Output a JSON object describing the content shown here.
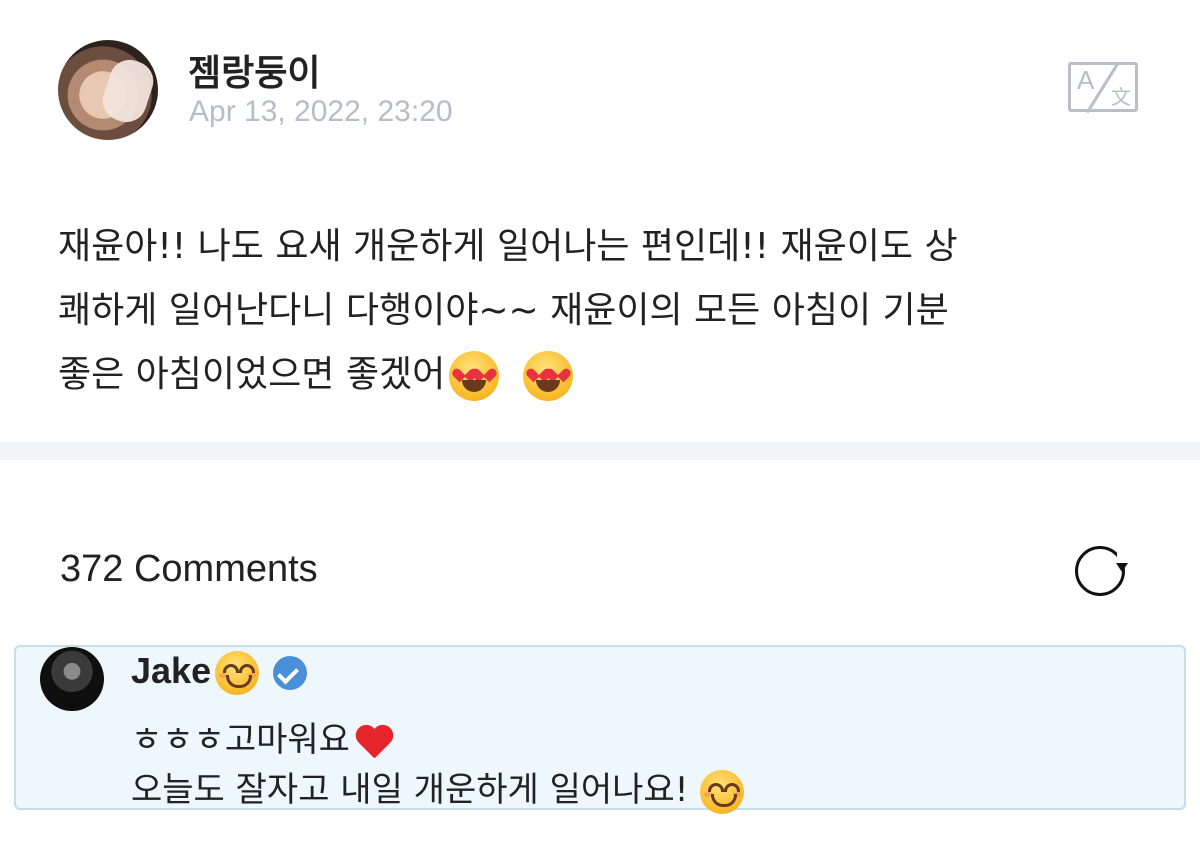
{
  "post": {
    "author": "젬랑둥이",
    "date": "Apr 13, 2022, 23:20",
    "body_line1": "재윤아!! 나도 요새 개운하게 일어나는 편인데!! 재윤이도 상",
    "body_line2": "쾌하게 일어난다니 다행이야~~ 재윤이의 모든 아침이 기분",
    "body_line3": "좋은 아침이었으면 좋겠어",
    "body_emojis": [
      "heart-eyes-emoji",
      "heart-eyes-emoji"
    ]
  },
  "translate": {
    "icon": "translate-icon",
    "left_glyph": "A",
    "right_glyph": "文"
  },
  "comments": {
    "header": "372 Comments",
    "refresh_icon": "refresh-icon",
    "items": [
      {
        "author": "Jake",
        "author_emoji": "smiling-face-emoji",
        "verified": true,
        "line1": "ㅎㅎㅎ고마워요",
        "line1_emoji": "red-heart-emoji",
        "line2": "오늘도 잘자고 내일 개운하게 일어나요!",
        "line2_emoji": "smiling-face-emoji"
      }
    ]
  },
  "colors": {
    "date_gray": "#b8bcc6",
    "divider": "#f3f4f7",
    "comment_highlight_bg": "#eef7fb",
    "comment_highlight_border": "#c6dfe9",
    "verified_blue": "#4a90d9"
  }
}
